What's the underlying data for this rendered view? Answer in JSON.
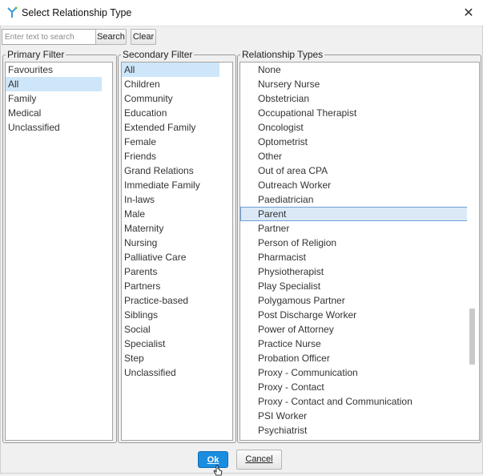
{
  "window": {
    "title": "Select Relationship Type",
    "close_glyph": "✕",
    "app_icon": "app-logo-icon"
  },
  "search": {
    "placeholder": "Enter text to search",
    "value": "",
    "search_label": "Search",
    "clear_label": "Clear"
  },
  "primary_filter": {
    "legend": "Primary Filter",
    "selected": "All",
    "items": [
      "Favourites",
      "All",
      "Family",
      "Medical",
      "Unclassified"
    ]
  },
  "secondary_filter": {
    "legend": "Secondary Filter",
    "selected": "All",
    "items": [
      "All",
      "Children",
      "Community",
      "Education",
      "Extended Family",
      "Female",
      "Friends",
      "Grand Relations",
      "Immediate Family",
      "In-laws",
      "Male",
      "Maternity",
      "Nursing",
      "Palliative Care",
      "Parents",
      "Partners",
      "Practice-based",
      "Siblings",
      "Social",
      "Specialist",
      "Step",
      "Unclassified"
    ]
  },
  "relationship_types": {
    "legend": "Relationship Types",
    "selected": "Parent",
    "items": [
      "None",
      "Nursery Nurse",
      "Obstetrician",
      "Occupational Therapist",
      "Oncologist",
      "Optometrist",
      "Other",
      "Out of area CPA",
      "Outreach Worker",
      "Paediatrician",
      "Parent",
      "Partner",
      "Person of Religion",
      "Pharmacist",
      "Physiotherapist",
      "Play Specialist",
      "Polygamous Partner",
      "Post Discharge Worker",
      "Power of Attorney",
      "Practice Nurse",
      "Probation Officer",
      "Proxy - Communication",
      "Proxy - Contact",
      "Proxy - Contact and Communication",
      "PSI Worker",
      "Psychiatrist"
    ]
  },
  "buttons": {
    "ok_label": "Ok",
    "cancel_label": "Cancel"
  },
  "colors": {
    "accent": "#1a8de0",
    "selection": "#cde6fa",
    "focus_border": "#6f9fd6"
  }
}
